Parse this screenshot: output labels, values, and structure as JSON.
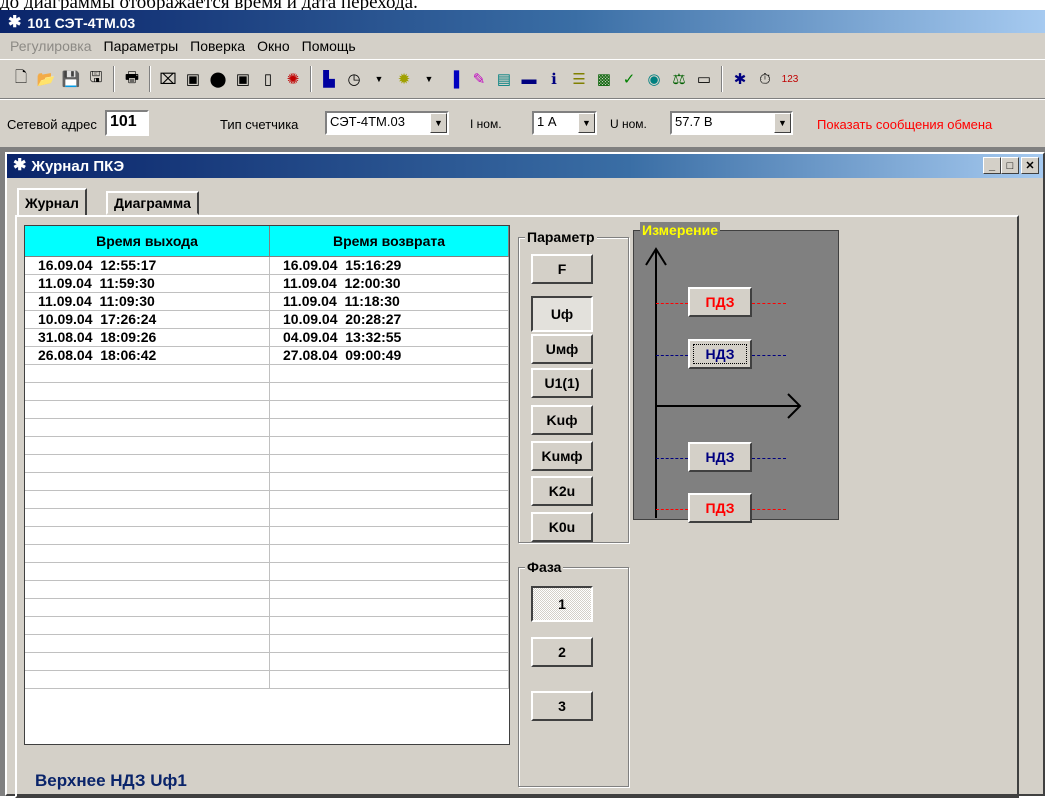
{
  "doc_text": "до диаграммы отображается время и дата перехода.",
  "app": {
    "title": "101  СЭТ-4ТМ.03"
  },
  "menu": [
    {
      "label": "Регулировка",
      "disabled": true
    },
    {
      "label": "Параметры",
      "disabled": false
    },
    {
      "label": "Поверка",
      "disabled": false
    },
    {
      "label": "Окно",
      "disabled": false
    },
    {
      "label": "Помощь",
      "disabled": false
    }
  ],
  "addr": {
    "net_label": "Сетевой адрес",
    "net_value": "101",
    "type_label": "Тип счетчика",
    "type_value": "СЭТ-4ТМ.03",
    "inom_label": "I ном.",
    "inom_value": "1 А",
    "unom_label": "U ном.",
    "unom_value": "57.7 В",
    "show_msg": "Показать сообщения обмена"
  },
  "window": {
    "title": "Журнал ПКЭ"
  },
  "tabs": [
    "Журнал",
    "Диаграмма"
  ],
  "table": {
    "headers": [
      "Время выхода",
      "Время возврата"
    ],
    "rows": [
      [
        "16.09.04  12:55:17",
        "16.09.04  15:16:29"
      ],
      [
        "11.09.04  11:59:30",
        "11.09.04  12:00:30"
      ],
      [
        "11.09.04  11:09:30",
        "11.09.04  11:18:30"
      ],
      [
        "10.09.04  17:26:24",
        "10.09.04  20:28:27"
      ],
      [
        "31.08.04  18:09:26",
        "04.09.04  13:32:55"
      ],
      [
        "26.08.04  18:06:42",
        "27.08.04  09:00:49"
      ]
    ]
  },
  "param": {
    "title": "Параметр",
    "buttons": [
      "F",
      "Uф",
      "Uмф",
      "U1(1)",
      "Kuф",
      "Kuмф",
      "K2u",
      "K0u"
    ],
    "selected": "Uф"
  },
  "phase": {
    "title": "Фаза",
    "buttons": [
      "1",
      "2",
      "3"
    ],
    "selected": "1"
  },
  "measure": {
    "title": "Измерение",
    "upper_pdz": "ПДЗ",
    "upper_ndz": "НДЗ",
    "lower_ndz": "НДЗ",
    "lower_pdz": "ПДЗ",
    "colors": {
      "pdz": "#ff0000",
      "ndz": "#000080"
    }
  },
  "status": "Верхнее НДЗ Uф1"
}
